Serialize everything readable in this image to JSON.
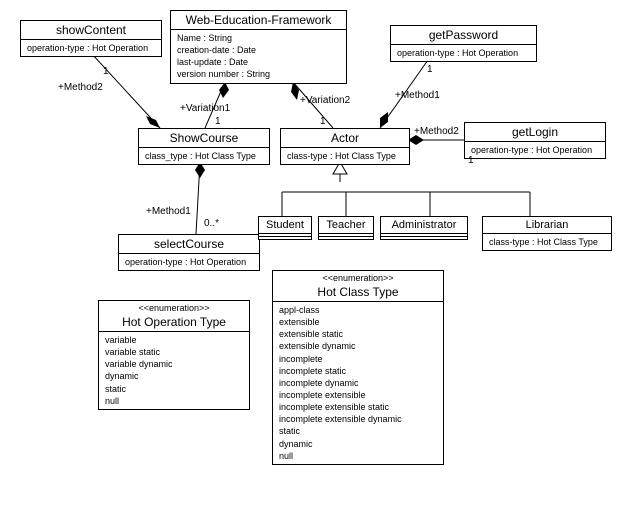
{
  "classes": {
    "showContent": {
      "name": "showContent",
      "attrs": [
        "operation-type : Hot Operation"
      ]
    },
    "wef": {
      "name": "Web-Education-Framework",
      "attrs": [
        "Name : String",
        "creation-date : Date",
        "last-update : Date",
        "version number : String"
      ]
    },
    "getPassword": {
      "name": "getPassword",
      "attrs": [
        "operation-type : Hot Operation"
      ]
    },
    "showCourse": {
      "name": "ShowCourse",
      "attrs": [
        "class_type : Hot Class Type"
      ]
    },
    "actor": {
      "name": "Actor",
      "attrs": [
        "class-type : Hot Class Type"
      ]
    },
    "getLogin": {
      "name": "getLogin",
      "attrs": [
        "operation-type : Hot Operation"
      ]
    },
    "selectCourse": {
      "name": "selectCourse",
      "attrs": [
        "operation-type : Hot Operation"
      ]
    },
    "student": {
      "name": "Student"
    },
    "teacher": {
      "name": "Teacher"
    },
    "administrator": {
      "name": "Administrator"
    },
    "librarian": {
      "name": "Librarian",
      "attrs": [
        "class-type : Hot Class Type"
      ]
    },
    "hotOp": {
      "stereo": "<<enumeration>>",
      "name": "Hot Operation Type",
      "attrs": [
        "variable",
        "variable static",
        "variable dynamic",
        "dynamic",
        "static",
        "null"
      ]
    },
    "hotClass": {
      "stereo": "<<enumeration>>",
      "name": "Hot Class Type",
      "attrs": [
        "appl-class",
        "extensible",
        "extensible static",
        "extensible dynamic",
        "incomplete",
        "incomplete static",
        "incomplete dynamic",
        "incomplete extensible",
        "incomplete extensible static",
        "incomplete extensible dynamic",
        "static",
        "dynamic",
        "null"
      ]
    }
  },
  "labels": {
    "method1a": "+Method1",
    "method1b": "+Method1",
    "method2a": "+Method2",
    "method2b": "+Method2",
    "variation1": "+Variation1",
    "variation2": "+Variation2",
    "m1a": "1",
    "m1b": "1",
    "m1c": "1",
    "m1d": "1",
    "m1e": "1",
    "m1f": "1",
    "m0s": "0..*"
  },
  "chart_data": {
    "type": "uml-class-diagram",
    "classes": [
      {
        "name": "showContent",
        "kind": "class",
        "attributes": [
          "operation-type : Hot Operation"
        ]
      },
      {
        "name": "Web-Education-Framework",
        "kind": "class",
        "attributes": [
          "Name : String",
          "creation-date : Date",
          "last-update : Date",
          "version number : String"
        ]
      },
      {
        "name": "getPassword",
        "kind": "class",
        "attributes": [
          "operation-type : Hot Operation"
        ]
      },
      {
        "name": "ShowCourse",
        "kind": "class",
        "attributes": [
          "class_type : Hot Class Type"
        ]
      },
      {
        "name": "Actor",
        "kind": "class",
        "attributes": [
          "class-type : Hot Class Type"
        ]
      },
      {
        "name": "getLogin",
        "kind": "class",
        "attributes": [
          "operation-type : Hot Operation"
        ]
      },
      {
        "name": "selectCourse",
        "kind": "class",
        "attributes": [
          "operation-type : Hot Operation"
        ]
      },
      {
        "name": "Student",
        "kind": "class"
      },
      {
        "name": "Teacher",
        "kind": "class"
      },
      {
        "name": "Administrator",
        "kind": "class"
      },
      {
        "name": "Librarian",
        "kind": "class",
        "attributes": [
          "class-type : Hot Class Type"
        ]
      },
      {
        "name": "Hot Operation Type",
        "kind": "enumeration",
        "literals": [
          "variable",
          "variable static",
          "variable dynamic",
          "dynamic",
          "static",
          "null"
        ]
      },
      {
        "name": "Hot Class Type",
        "kind": "enumeration",
        "literals": [
          "appl-class",
          "extensible",
          "extensible static",
          "extensible dynamic",
          "incomplete",
          "incomplete static",
          "incomplete dynamic",
          "incomplete extensible",
          "incomplete extensible static",
          "incomplete extensible dynamic",
          "static",
          "dynamic",
          "null"
        ]
      }
    ],
    "relations": [
      {
        "from": "Web-Education-Framework",
        "to": "ShowCourse",
        "type": "composition",
        "role": "+Variation1",
        "multiplicity_to": "1"
      },
      {
        "from": "Web-Education-Framework",
        "to": "Actor",
        "type": "composition",
        "role": "+Variation2",
        "multiplicity_to": "1"
      },
      {
        "from": "ShowCourse",
        "to": "showContent",
        "type": "composition",
        "role": "+Method2",
        "multiplicity_to": "1"
      },
      {
        "from": "ShowCourse",
        "to": "selectCourse",
        "type": "composition",
        "role": "+Method1",
        "multiplicity_to": "0..*"
      },
      {
        "from": "Actor",
        "to": "getPassword",
        "type": "composition",
        "role": "+Method1",
        "multiplicity_to": "1"
      },
      {
        "from": "Actor",
        "to": "getLogin",
        "type": "composition",
        "role": "+Method2",
        "multiplicity_to": "1"
      },
      {
        "from": "Student",
        "to": "Actor",
        "type": "generalization"
      },
      {
        "from": "Teacher",
        "to": "Actor",
        "type": "generalization"
      },
      {
        "from": "Administrator",
        "to": "Actor",
        "type": "generalization"
      },
      {
        "from": "Librarian",
        "to": "Actor",
        "type": "generalization"
      }
    ]
  }
}
